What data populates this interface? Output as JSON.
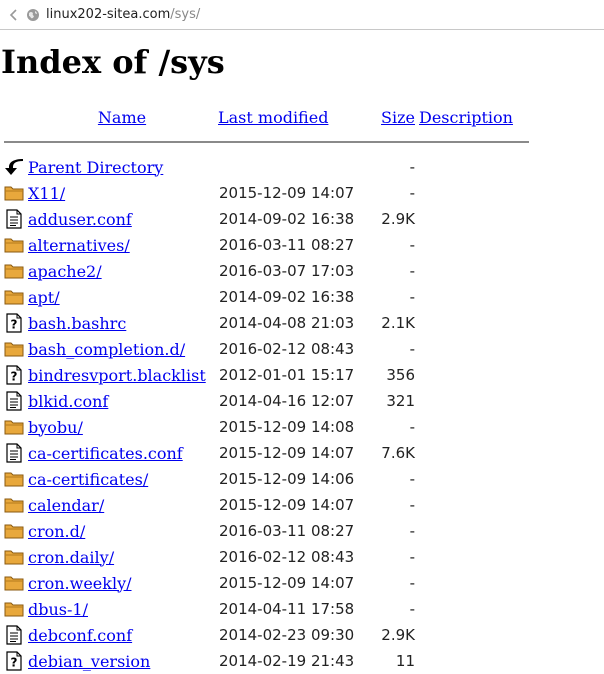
{
  "browser": {
    "url_host": "linux202-sitea.com",
    "url_path": "/sys/"
  },
  "page": {
    "title": "Index of /sys"
  },
  "table": {
    "headers": {
      "name": "Name",
      "last_modified": "Last modified",
      "size": "Size",
      "description": "Description"
    },
    "rows": [
      {
        "icon": "back",
        "name": "Parent Directory",
        "modified": "",
        "size": "-"
      },
      {
        "icon": "folder",
        "name": "X11/",
        "modified": "2015-12-09 14:07",
        "size": "-"
      },
      {
        "icon": "text",
        "name": "adduser.conf",
        "modified": "2014-09-02 16:38",
        "size": "2.9K"
      },
      {
        "icon": "folder",
        "name": "alternatives/",
        "modified": "2016-03-11 08:27",
        "size": "-"
      },
      {
        "icon": "folder",
        "name": "apache2/",
        "modified": "2016-03-07 17:03",
        "size": "-"
      },
      {
        "icon": "folder",
        "name": "apt/",
        "modified": "2014-09-02 16:38",
        "size": "-"
      },
      {
        "icon": "unknown",
        "name": "bash.bashrc",
        "modified": "2014-04-08 21:03",
        "size": "2.1K"
      },
      {
        "icon": "folder",
        "name": "bash_completion.d/",
        "modified": "2016-02-12 08:43",
        "size": "-"
      },
      {
        "icon": "unknown",
        "name": "bindresvport.blacklist",
        "modified": "2012-01-01 15:17",
        "size": "356"
      },
      {
        "icon": "text",
        "name": "blkid.conf",
        "modified": "2014-04-16 12:07",
        "size": "321"
      },
      {
        "icon": "folder",
        "name": "byobu/",
        "modified": "2015-12-09 14:08",
        "size": "-"
      },
      {
        "icon": "text",
        "name": "ca-certificates.conf",
        "modified": "2015-12-09 14:07",
        "size": "7.6K"
      },
      {
        "icon": "folder",
        "name": "ca-certificates/",
        "modified": "2015-12-09 14:06",
        "size": "-"
      },
      {
        "icon": "folder",
        "name": "calendar/",
        "modified": "2015-12-09 14:07",
        "size": "-"
      },
      {
        "icon": "folder",
        "name": "cron.d/",
        "modified": "2016-03-11 08:27",
        "size": "-"
      },
      {
        "icon": "folder",
        "name": "cron.daily/",
        "modified": "2016-02-12 08:43",
        "size": "-"
      },
      {
        "icon": "folder",
        "name": "cron.weekly/",
        "modified": "2015-12-09 14:07",
        "size": "-"
      },
      {
        "icon": "folder",
        "name": "dbus-1/",
        "modified": "2014-04-11 17:58",
        "size": "-"
      },
      {
        "icon": "text",
        "name": "debconf.conf",
        "modified": "2014-02-23 09:30",
        "size": "2.9K"
      },
      {
        "icon": "unknown",
        "name": "debian_version",
        "modified": "2014-02-19 21:43",
        "size": "11"
      }
    ]
  }
}
